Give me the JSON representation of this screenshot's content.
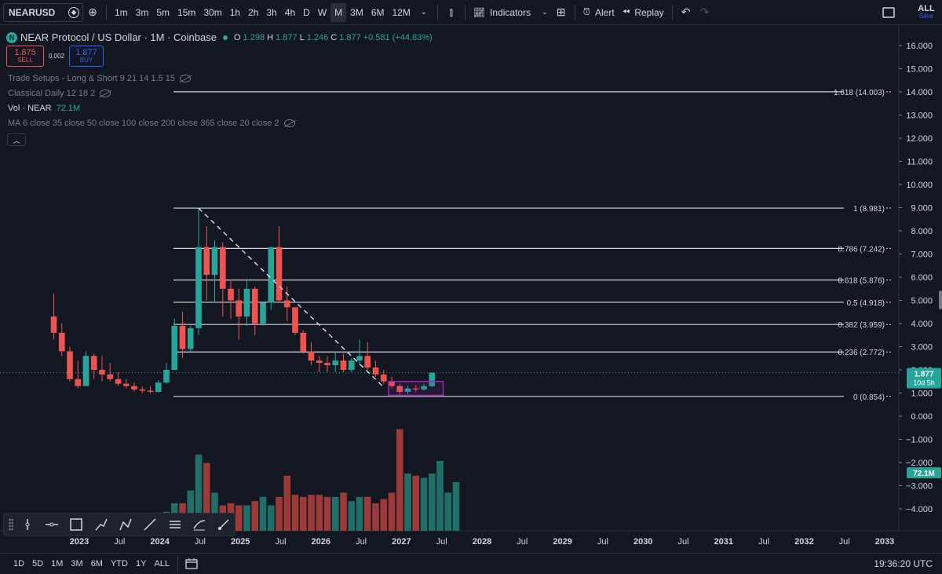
{
  "toolbar": {
    "symbol": "NEARUSD",
    "intervals": [
      "1m",
      "3m",
      "5m",
      "15m",
      "30m",
      "1h",
      "2h",
      "3h",
      "4h",
      "D",
      "W",
      "M",
      "3M",
      "6M",
      "12M"
    ],
    "active_interval": "M",
    "indicators_label": "Indicators",
    "alert_label": "Alert",
    "replay_label": "Replay",
    "layout_label": "ALL",
    "save_label": "Save"
  },
  "legend": {
    "title": "NEAR Protocol / US Dollar · 1M · Coinbase",
    "logo_letter": "N",
    "o_label": "O",
    "o": "1.298",
    "h_label": "H",
    "h": "1.877",
    "l_label": "L",
    "l": "1.246",
    "c_label": "C",
    "c": "1.877",
    "change": "+0.581 (+44.83%)"
  },
  "trade": {
    "sell_price": "1.875",
    "sell_label": "SELL",
    "spread": "0.002",
    "buy_price": "1.877",
    "buy_label": "BUY"
  },
  "indicators": [
    "Trade Setups - Long & Short 9 21 14 1.5 15",
    "Classical Daily 12 18 2"
  ],
  "volume_indicator": {
    "label": "Vol · NEAR",
    "value": "72.1M"
  },
  "ma_indicator": "MA 6 close 35 close 50 close 100 close 200 close 365 close 20 close 2",
  "chart_data": {
    "type": "candlestick",
    "y_axis_labels": [
      "16.000",
      "15.000",
      "14.000",
      "13.000",
      "12.000",
      "11.000",
      "10.000",
      "9.000",
      "8.000",
      "7.000",
      "6.000",
      "5.000",
      "4.000",
      "3.000",
      "2.000",
      "1.000",
      "0.000",
      "−1.000",
      "−2.000",
      "−3.000",
      "−4.000"
    ],
    "y_axis_values": [
      16,
      15,
      14,
      13,
      12,
      11,
      10,
      9,
      8,
      7,
      6,
      5,
      4,
      3,
      2,
      1,
      0,
      -1,
      -2,
      -3,
      -4
    ],
    "x_axis_labels": [
      "2023",
      "Jul",
      "2024",
      "Jul",
      "2025",
      "Jul",
      "2026",
      "Jul",
      "2027",
      "Jul",
      "2028",
      "Jul",
      "2029",
      "Jul",
      "2030",
      "Jul",
      "2031",
      "Jul",
      "2032",
      "Jul",
      "2033"
    ],
    "ylim": [
      -4,
      16.5
    ],
    "candles": [
      {
        "o": 4.3,
        "h": 5.3,
        "l": 3.3,
        "c": 3.6
      },
      {
        "o": 3.6,
        "h": 4.0,
        "l": 2.6,
        "c": 2.8
      },
      {
        "o": 2.8,
        "h": 3.0,
        "l": 1.5,
        "c": 1.6
      },
      {
        "o": 1.6,
        "h": 2.4,
        "l": 1.2,
        "c": 1.3
      },
      {
        "o": 1.3,
        "h": 2.8,
        "l": 1.3,
        "c": 2.6
      },
      {
        "o": 2.6,
        "h": 2.7,
        "l": 1.6,
        "c": 2.0
      },
      {
        "o": 2.0,
        "h": 2.6,
        "l": 1.5,
        "c": 1.8
      },
      {
        "o": 1.8,
        "h": 2.3,
        "l": 1.5,
        "c": 1.6
      },
      {
        "o": 1.6,
        "h": 1.9,
        "l": 1.3,
        "c": 1.4
      },
      {
        "o": 1.4,
        "h": 1.6,
        "l": 1.2,
        "c": 1.3
      },
      {
        "o": 1.3,
        "h": 1.45,
        "l": 1.05,
        "c": 1.15
      },
      {
        "o": 1.15,
        "h": 1.3,
        "l": 1.0,
        "c": 1.1
      },
      {
        "o": 1.1,
        "h": 1.3,
        "l": 1.0,
        "c": 1.05
      },
      {
        "o": 1.05,
        "h": 1.55,
        "l": 1.0,
        "c": 1.45
      },
      {
        "o": 1.45,
        "h": 2.3,
        "l": 1.4,
        "c": 2.0
      },
      {
        "o": 2.0,
        "h": 4.2,
        "l": 2.0,
        "c": 3.9
      },
      {
        "o": 3.9,
        "h": 4.5,
        "l": 2.5,
        "c": 2.9
      },
      {
        "o": 2.9,
        "h": 3.9,
        "l": 2.8,
        "c": 3.8
      },
      {
        "o": 3.8,
        "h": 8.98,
        "l": 3.5,
        "c": 7.3
      },
      {
        "o": 7.3,
        "h": 8.2,
        "l": 5.0,
        "c": 6.1
      },
      {
        "o": 6.1,
        "h": 7.6,
        "l": 4.9,
        "c": 7.3
      },
      {
        "o": 7.3,
        "h": 7.5,
        "l": 4.3,
        "c": 5.5
      },
      {
        "o": 5.5,
        "h": 5.9,
        "l": 4.2,
        "c": 5.0
      },
      {
        "o": 5.0,
        "h": 5.5,
        "l": 3.3,
        "c": 4.3
      },
      {
        "o": 4.3,
        "h": 5.9,
        "l": 3.9,
        "c": 5.5
      },
      {
        "o": 5.5,
        "h": 5.6,
        "l": 3.5,
        "c": 4.0
      },
      {
        "o": 4.0,
        "h": 4.9,
        "l": 3.9,
        "c": 4.9
      },
      {
        "o": 4.9,
        "h": 7.3,
        "l": 4.6,
        "c": 7.3
      },
      {
        "o": 7.3,
        "h": 8.2,
        "l": 4.9,
        "c": 5.0
      },
      {
        "o": 5.0,
        "h": 5.6,
        "l": 4.1,
        "c": 4.7
      },
      {
        "o": 4.7,
        "h": 4.7,
        "l": 3.5,
        "c": 3.6
      },
      {
        "o": 3.6,
        "h": 3.7,
        "l": 2.7,
        "c": 2.8
      },
      {
        "o": 2.8,
        "h": 3.2,
        "l": 2.2,
        "c": 2.4
      },
      {
        "o": 2.4,
        "h": 2.6,
        "l": 1.9,
        "c": 2.3
      },
      {
        "o": 2.3,
        "h": 2.6,
        "l": 1.9,
        "c": 2.2
      },
      {
        "o": 2.2,
        "h": 2.8,
        "l": 1.9,
        "c": 2.4
      },
      {
        "o": 2.4,
        "h": 2.7,
        "l": 1.9,
        "c": 2.0
      },
      {
        "o": 2.0,
        "h": 2.5,
        "l": 1.9,
        "c": 2.4
      },
      {
        "o": 2.4,
        "h": 3.3,
        "l": 2.2,
        "c": 2.6
      },
      {
        "o": 2.6,
        "h": 3.2,
        "l": 2.0,
        "c": 2.1
      },
      {
        "o": 2.1,
        "h": 2.4,
        "l": 1.7,
        "c": 1.8
      },
      {
        "o": 1.8,
        "h": 2.0,
        "l": 1.4,
        "c": 1.5
      },
      {
        "o": 1.5,
        "h": 1.7,
        "l": 1.2,
        "c": 1.3
      },
      {
        "o": 1.3,
        "h": 1.4,
        "l": 0.93,
        "c": 1.05
      },
      {
        "o": 1.05,
        "h": 1.3,
        "l": 0.95,
        "c": 1.2
      },
      {
        "o": 1.2,
        "h": 1.35,
        "l": 1.05,
        "c": 1.15
      },
      {
        "o": 1.15,
        "h": 1.4,
        "l": 1.1,
        "c": 1.3
      },
      {
        "o": 1.298,
        "h": 1.877,
        "l": 1.246,
        "c": 1.877
      }
    ],
    "volumes": [
      0.5,
      0.6,
      0.4,
      0.4,
      0.3,
      0.3,
      0.3,
      0.2,
      0.3,
      0.2,
      0.3,
      0.2,
      0.3,
      0.5,
      0.9,
      1.3,
      1.3,
      1.9,
      3.6,
      3.2,
      1.8,
      1.2,
      1.3,
      1.2,
      1.2,
      1.4,
      1.6,
      1.2,
      1.6,
      2.6,
      1.7,
      1.6,
      1.7,
      1.7,
      1.6,
      1.6,
      1.8,
      1.4,
      1.6,
      1.6,
      1.3,
      1.5,
      1.8,
      4.8,
      2.7,
      2.6,
      2.5,
      2.7,
      3.3,
      1.8,
      2.3
    ],
    "fib_levels": [
      {
        "label": "1.618 (14.003)",
        "value": 14.003
      },
      {
        "label": "1 (8.981)",
        "value": 8.981
      },
      {
        "label": "0.786 (7.242)",
        "value": 7.242
      },
      {
        "label": "0.618 (5.876)",
        "value": 5.876
      },
      {
        "label": "0.5 (4.918)",
        "value": 4.918
      },
      {
        "label": "0.382 (3.959)",
        "value": 3.959
      },
      {
        "label": "0.236 (2.772)",
        "value": 2.772
      },
      {
        "label": "0 (0.854)",
        "value": 0.854
      }
    ],
    "trend_line": {
      "from_index": 18,
      "from_value": 8.98,
      "to_index": 41,
      "to_value": 1.25
    },
    "box": {
      "from_index": 42,
      "to_index": 48,
      "top": 1.5,
      "bottom": 0.9
    },
    "last_price": "1.877",
    "countdown": "10d 5h",
    "volume_badge": "72.1M",
    "colors": {
      "up": "#26a69a",
      "down": "#ef5350",
      "vol_up": "#1f6f68",
      "vol_down": "#9c3a3a",
      "fib": "#d1d4dc",
      "box": "#9c27b0",
      "trend": "#d1d4dc"
    }
  },
  "ranges": [
    "1D",
    "5D",
    "1M",
    "3M",
    "6M",
    "YTD",
    "1Y",
    "ALL"
  ],
  "clock": "19:36:20 UTC"
}
